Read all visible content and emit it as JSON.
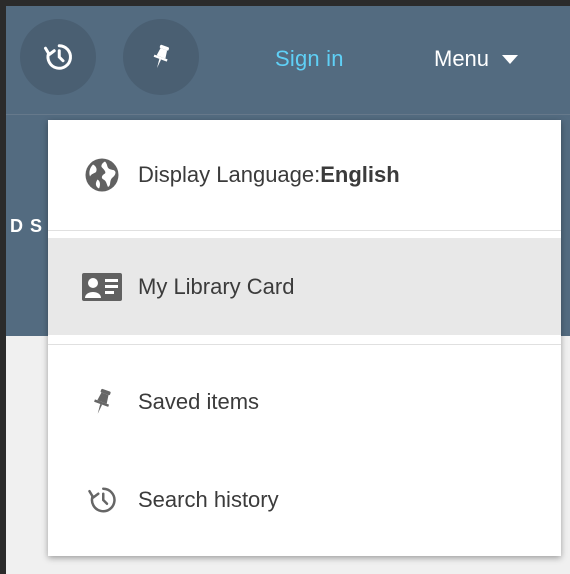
{
  "header": {
    "signin_label": "Sign in",
    "menu_label": "Menu",
    "partial_text": "D S"
  },
  "menu": {
    "language_label": "Display Language:",
    "language_value": "English",
    "library_card": "My Library Card",
    "saved_items": "Saved items",
    "search_history": "Search history"
  },
  "colors": {
    "header_bg": "#536b80",
    "signin": "#5fd0f6",
    "highlight": "#e8e8e8"
  },
  "icons": [
    "history-icon",
    "pin-icon",
    "caret-down-icon",
    "globe-icon",
    "id-card-icon",
    "pin-icon",
    "history-icon"
  ]
}
